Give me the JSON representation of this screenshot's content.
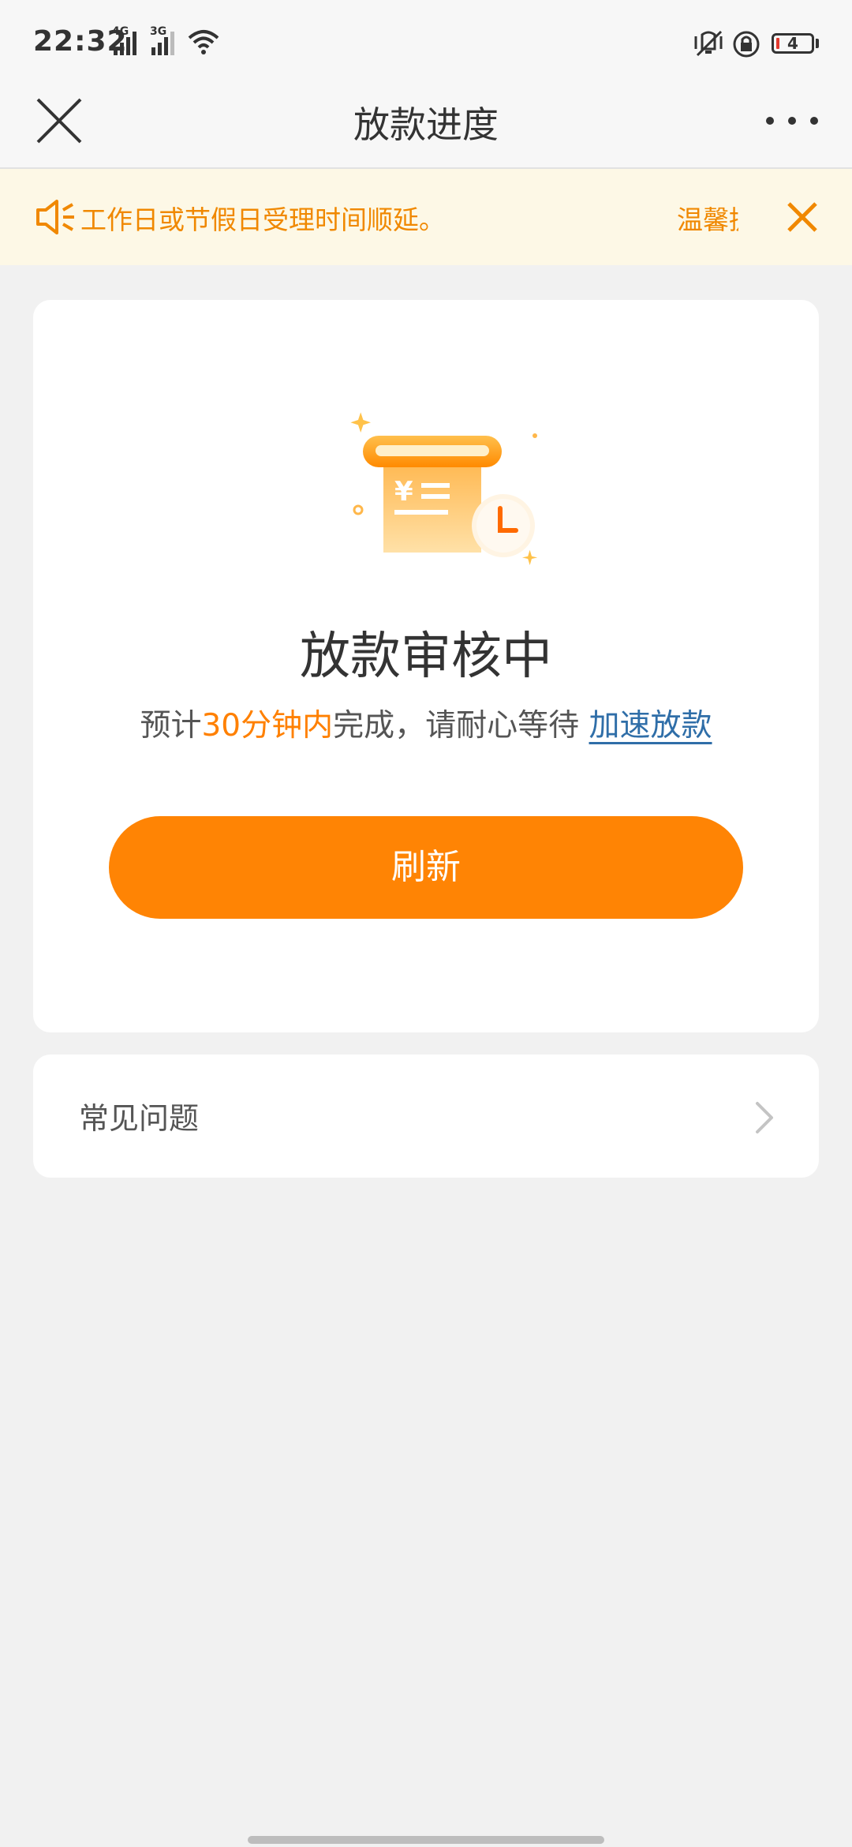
{
  "status_bar": {
    "time": "22:32",
    "signal1_net": "4G",
    "signal2_net": "3G",
    "battery_level": "4"
  },
  "nav": {
    "title": "放款进度"
  },
  "notice": {
    "text": "工作日或节假日受理时间顺延。",
    "text_next": "温馨提"
  },
  "status": {
    "title": "放款审核中",
    "subtitle_prefix": "预计",
    "subtitle_highlight": "30分钟内",
    "subtitle_suffix": "完成，请耐心等待 ",
    "speedup_link": "加速放款"
  },
  "refresh_button": "刷新",
  "faq": {
    "label": "常见问题"
  },
  "colors": {
    "accent": "#ff8404",
    "notice_bg": "#fdf8e6",
    "notice_text": "#f08800",
    "link": "#2f6ea8"
  }
}
